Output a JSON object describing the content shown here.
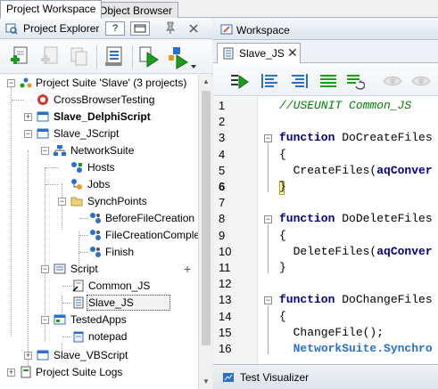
{
  "top_tabs": [
    {
      "label": "Project Workspace",
      "active": true
    },
    {
      "label": "Object Browser",
      "active": false
    }
  ],
  "explorer": {
    "title": "Project Explorer",
    "help_label": "?",
    "tree": {
      "root": "Project Suite 'Slave' (3 projects)",
      "cross_browser": "CrossBrowserTesting",
      "delphi": "Slave_DelphiScript",
      "jscript": "Slave_JScript",
      "network_suite": "NetworkSuite",
      "hosts": "Hosts",
      "jobs": "Jobs",
      "synch_points": "SynchPoints",
      "before_file_creation": "BeforeFileCreation",
      "file_creation_complete": "FileCreationComplete",
      "finish": "Finish",
      "script": "Script",
      "common_js": "Common_JS",
      "slave_js": "Slave_JS",
      "tested_apps": "TestedApps",
      "notepad": "notepad",
      "vbscript": "Slave_VBScript",
      "logs": "Project Suite Logs",
      "add_glyph": "+"
    }
  },
  "workspace": {
    "title": "Workspace",
    "doc_tab": "Slave_JS",
    "close_glyph": "✕",
    "bottom_label": "Test Visualizer"
  },
  "editor": {
    "lines": [
      {
        "num": "1",
        "text": "//USEUNIT Common_JS",
        "kind": "comment"
      },
      {
        "num": "2",
        "text": "",
        "kind": "plain"
      },
      {
        "num": "3",
        "text": "function DoCreateFiles",
        "kind": "func"
      },
      {
        "num": "4",
        "text": "{",
        "kind": "plain"
      },
      {
        "num": "5",
        "text": "  CreateFiles(aqConver",
        "kind": "call"
      },
      {
        "num": "6",
        "text": "}",
        "kind": "plain"
      },
      {
        "num": "7",
        "text": "",
        "kind": "plain"
      },
      {
        "num": "8",
        "text": "function DoDeleteFiles",
        "kind": "func"
      },
      {
        "num": "9",
        "text": "{",
        "kind": "plain"
      },
      {
        "num": "10",
        "text": "  DeleteFiles(aqConver",
        "kind": "call"
      },
      {
        "num": "11",
        "text": "}",
        "kind": "plain"
      },
      {
        "num": "12",
        "text": "",
        "kind": "plain"
      },
      {
        "num": "13",
        "text": "function DoChangeFiles",
        "kind": "func"
      },
      {
        "num": "14",
        "text": "{",
        "kind": "plain"
      },
      {
        "num": "15",
        "text": "  ChangeFile();",
        "kind": "plain"
      },
      {
        "num": "16",
        "text": "  NetworkSuite.Synchro",
        "kind": "netsuite"
      }
    ],
    "current_line": "6"
  },
  "colors": {
    "keyword": "#000080",
    "comment": "#008000",
    "accent_green": "#1a9e1a",
    "accent_blue": "#2a6fc9"
  }
}
